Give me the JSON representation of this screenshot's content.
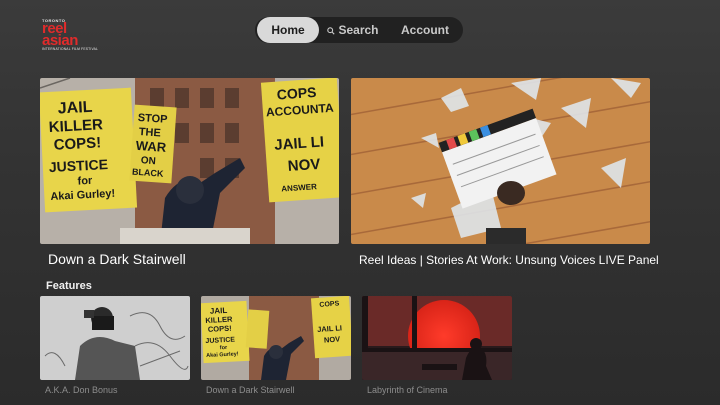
{
  "logo": {
    "top": "TORONTO",
    "word": "reel asian",
    "sub": "INTERNATIONAL FILM FESTIVAL"
  },
  "nav": {
    "home": "Home",
    "search": "Search",
    "account": "Account"
  },
  "featured": [
    {
      "title": "Down a Dark Stairwell",
      "signs": [
        "JAIL",
        "KILLER",
        "COPS!",
        "JUSTICE",
        "for",
        "Akai Gurley!",
        "STOP",
        "THE",
        "WAR",
        "ON",
        "BLACK",
        "COPS",
        "ACCOUNTA",
        "JAIL LI",
        "NOV",
        "ANSWER"
      ]
    },
    {
      "title": "Reel Ideas | Stories At Work: Unsung Voices LIVE Panel"
    }
  ],
  "features": {
    "label": "Features",
    "items": [
      {
        "caption": "A.K.A. Don Bonus"
      },
      {
        "caption": "Down a Dark Stairwell"
      },
      {
        "caption": "Labyrinth of Cinema"
      }
    ]
  }
}
